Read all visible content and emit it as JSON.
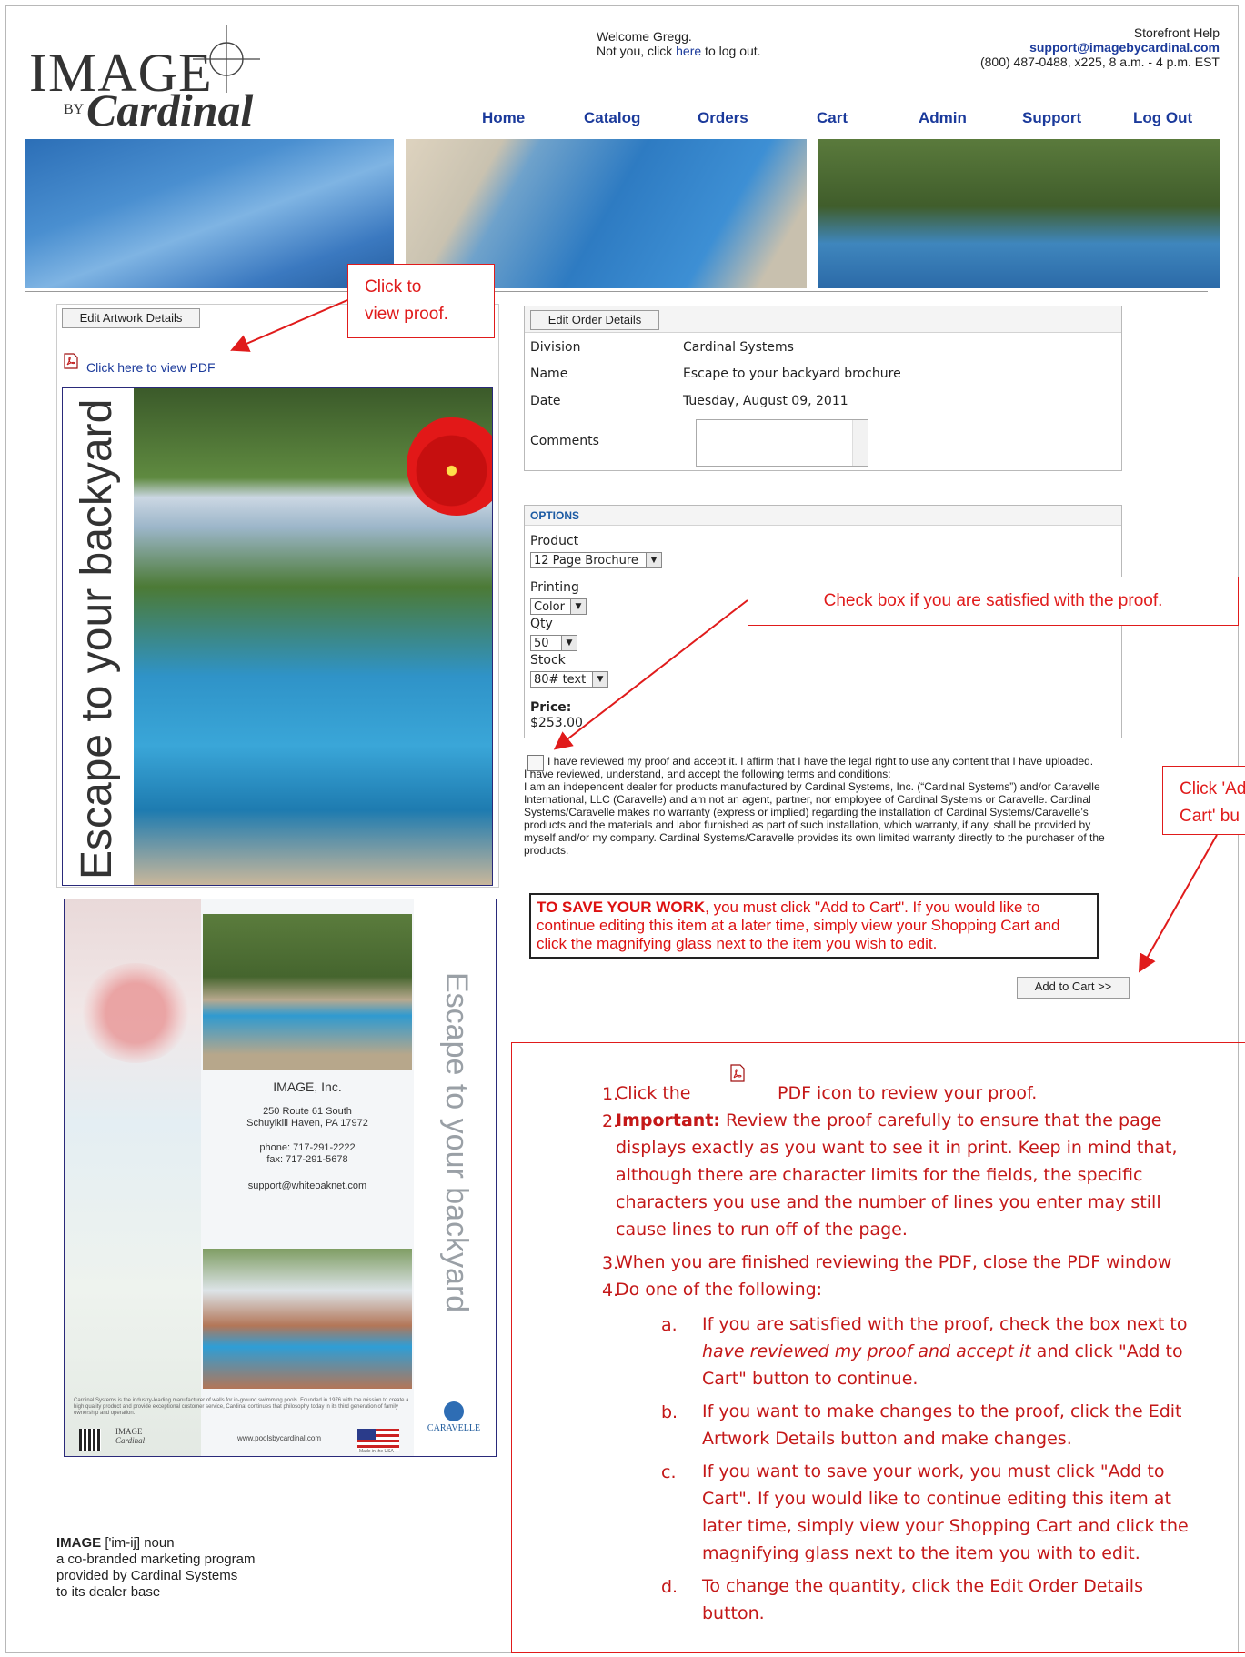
{
  "header": {
    "logo_main": "IMAGE",
    "logo_by": "BY",
    "logo_script": "Cardinal",
    "welcome_line1": "Welcome Gregg.",
    "welcome_line2_pre": "Not you, click ",
    "welcome_link": "here",
    "welcome_line2_post": " to log out.",
    "help_title": "Storefront Help",
    "help_email": "support@imagebycardinal.com",
    "help_phone": "(800) 487-0488, x225, 8 a.m. - 4 p.m. EST"
  },
  "nav": [
    {
      "label": "Home"
    },
    {
      "label": "Catalog"
    },
    {
      "label": "Orders"
    },
    {
      "label": "Cart"
    },
    {
      "label": "Admin"
    },
    {
      "label": "Support"
    },
    {
      "label": "Log Out"
    }
  ],
  "left": {
    "edit_artwork_label": "Edit Artwork Details",
    "pdf_link": "Click here to view PDF",
    "proof_title": "Escape to your backyard",
    "proof2_vertical": "Escape to your backyard",
    "proof2_company": "IMAGE, Inc.",
    "proof2_address1": "250 Route 61 South",
    "proof2_address2": "Schuylkill Haven, PA 17972",
    "proof2_phone": "phone: 717-291-2222",
    "proof2_fax": "fax: 717-291-5678",
    "proof2_email": "support@whiteoaknet.com",
    "proof2_footer": "Cardinal Systems is the industry-leading manufacturer of walls for in-ground swimming pools. Founded in 1976 with the mission to create a high quality product and provide exceptional customer service, Cardinal continues that philosophy today in its third generation of family ownership and operation.",
    "proof2_logo_image": "IMAGE",
    "proof2_logo_cardinal": "Cardinal",
    "proof2_site": "www.poolsbycardinal.com",
    "proof2_made": "Made in the USA",
    "proof2_caravelle": "CARAVELLE",
    "definition_word": "IMAGE",
    "definition_rest": " ['im-ij] noun",
    "definition_l2": "a co-branded marketing program",
    "definition_l3": "provided by Cardinal Systems",
    "definition_l4": "to its dealer base"
  },
  "callouts": {
    "view_proof_l1": "Click to",
    "view_proof_l2": "view proof.",
    "check_box": "Check box if you are satisfied with the proof.",
    "add_cart_l1": "Click 'Ad",
    "add_cart_l2": "Cart' bu"
  },
  "order": {
    "edit_order_label": "Edit Order Details",
    "division_label": "Division",
    "division_value": "Cardinal Systems",
    "name_label": "Name",
    "name_value": "Escape to your backyard brochure",
    "date_label": "Date",
    "date_value": "Tuesday, August 09, 2011",
    "comments_label": "Comments"
  },
  "options": {
    "heading": "OPTIONS",
    "product_label": "Product",
    "product_value": "12 Page Brochure",
    "printing_label": "Printing",
    "printing_value": "Color",
    "qty_label": "Qty",
    "qty_value": "50",
    "stock_label": "Stock",
    "stock_value": "80# text",
    "price_label": "Price:",
    "price_value": "$253.00"
  },
  "terms": {
    "accept": "I have reviewed my proof and accept it. I affirm that I have the legal right to use any content that I have uploaded.",
    "line2": "I have reviewed, understand, and accept the following terms and conditions:",
    "body": "I am an independent dealer for products manufactured by Cardinal Systems, Inc. (“Cardinal Systems”) and/or Caravelle International, LLC (Caravelle) and am not an agent, partner, nor employee of Cardinal Systems or Caravelle. Cardinal Systems/Caravelle makes no warranty (express or implied) regarding the installation of Cardinal Systems/Caravelle’s products and the materials and labor furnished as part of such installation, which warranty, if any, shall be provided by myself and/or my company. Cardinal Systems/Caravelle provides its own limited warranty directly to the purchaser of the products."
  },
  "save_notice": {
    "bold": "TO SAVE YOUR WORK",
    "rest": ", you must click \"Add to Cart\". If you would like to continue editing this item at a later time, simply view your Shopping Cart and click the magnifying glass next to the item you wish to edit."
  },
  "add_to_cart_label": "Add to Cart >>",
  "instructions": {
    "n1": "1.",
    "n2": "2.",
    "n3": "3.",
    "n4": "4.",
    "i1_pre": "Click the",
    "i1_post": "PDF icon to review your proof.",
    "i2_bold": "Important:",
    "i2_l1": " Review the proof carefully to ensure that the page",
    "i2_l2": "displays exactly as you want to see it in print. Keep in mind that,",
    "i2_l3": "although there are character limits for the fields, the specific",
    "i2_l4": "characters you use and the number of lines you enter may still",
    "i2_l5": "cause lines to run off of the page.",
    "i3": "When you are finished reviewing the PDF, close the PDF window",
    "i4": "Do one of the following:",
    "a": "a.",
    "b": "b.",
    "c": "c.",
    "d": "d.",
    "a_l1": "If you are satisfied with the proof, check the box next to",
    "a_l2_it": "have reviewed my proof and accept it",
    "a_l2_rest": "  and click \"Add to",
    "a_l3": "Cart\" button to continue.",
    "b_l1": "If you want to make changes to the proof, click the Edit",
    "b_l2": "Artwork Details button and make changes.",
    "c_l1": "If you want to save your work, you must click \"Add to",
    "c_l2": "Cart\".  If you would like to continue editing this item at",
    "c_l3": "later time, simply view your Shopping Cart and click the",
    "c_l4": "magnifying glass next to the item you with to edit.",
    "d_l1": "To change the quantity, click the Edit Order Details",
    "d_l2": "button."
  },
  "colors": {
    "link_blue": "#1b3a9b",
    "callout_red": "#e01b1b",
    "instruction_red": "#c41818"
  }
}
